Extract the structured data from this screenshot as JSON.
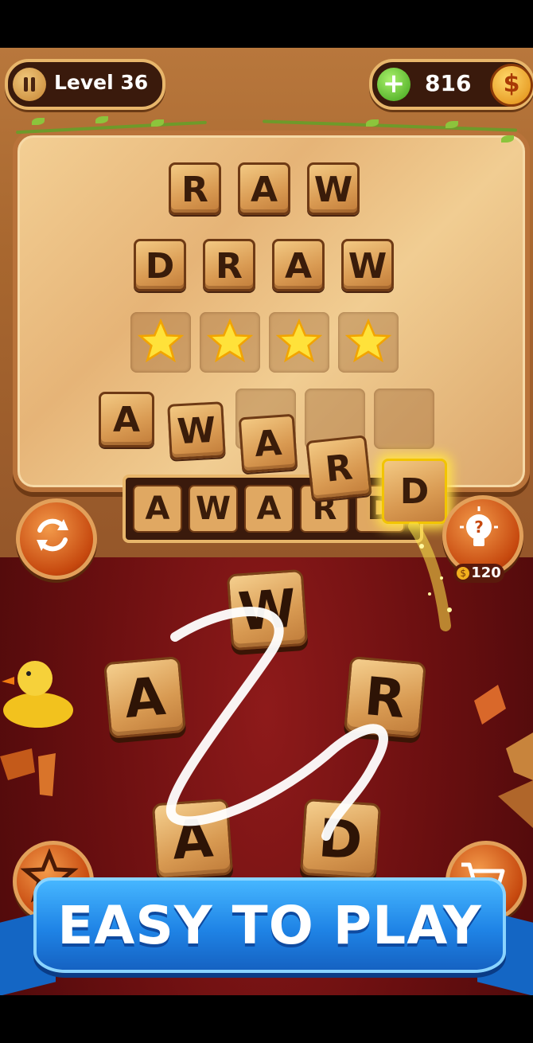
{
  "hud": {
    "level_label": "Level 36",
    "coins": "816",
    "coin_symbol": "$"
  },
  "board": {
    "solved_words": [
      [
        "R",
        "A",
        "W"
      ],
      [
        "D",
        "R",
        "A",
        "W"
      ]
    ],
    "star_slots": 4,
    "current_row": [
      "A",
      "W",
      "A",
      "R",
      "D"
    ],
    "preview_word": "AWARD"
  },
  "controls": {
    "shuffle_icon": "shuffle-icon",
    "hint_icon": "lightbulb-icon",
    "hint_cost": "120",
    "favorites_icon": "star-icon",
    "shop_icon": "cart-icon"
  },
  "wheel": {
    "letters": [
      "W",
      "A",
      "R",
      "A",
      "D"
    ]
  },
  "promo": {
    "banner_text": "EASY TO PLAY"
  },
  "colors": {
    "accent_gold": "#e8b66b",
    "ribbon_blue": "#1f84e6",
    "felt_red": "#6a0f10",
    "star_yellow": "#ffe23a"
  }
}
